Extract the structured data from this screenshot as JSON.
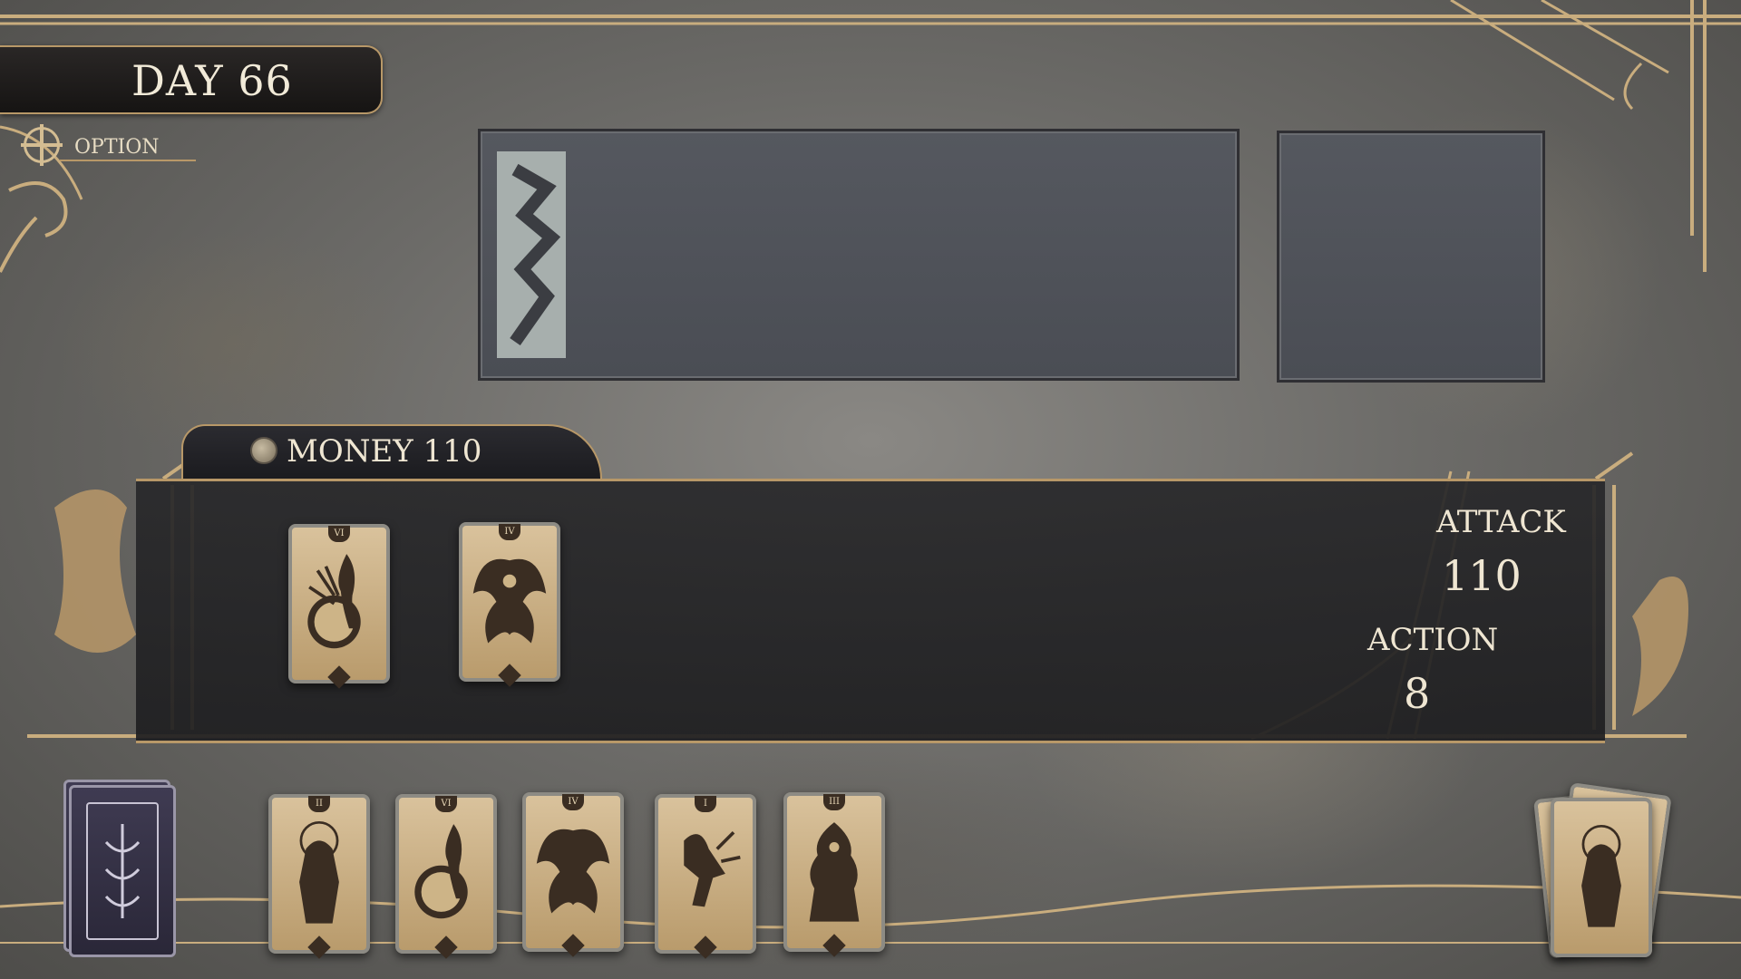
{
  "header": {
    "day_label": "DAY 66",
    "option_label": "OPTION"
  },
  "money": {
    "label": "MONEY 110"
  },
  "stats": {
    "attack_label": "ATTACK",
    "attack_value": "110",
    "action_label": "ACTION",
    "action_value": "8"
  },
  "board_cards": [
    {
      "numeral": "VI",
      "art": "dancer-globe"
    },
    {
      "numeral": "IV",
      "art": "winged-demon"
    }
  ],
  "hand_cards": [
    {
      "numeral": "II",
      "art": "armored-knight"
    },
    {
      "numeral": "VI",
      "art": "dancer-globe"
    },
    {
      "numeral": "IV",
      "art": "winged-demon"
    },
    {
      "numeral": "I",
      "art": "running-figure"
    },
    {
      "numeral": "III",
      "art": "flame-giant"
    }
  ],
  "colors": {
    "gold": "#c9ad7e",
    "panel": "#4f5259",
    "board": "#27272a",
    "card": "#cdb487",
    "ink": "#3a2d22"
  }
}
